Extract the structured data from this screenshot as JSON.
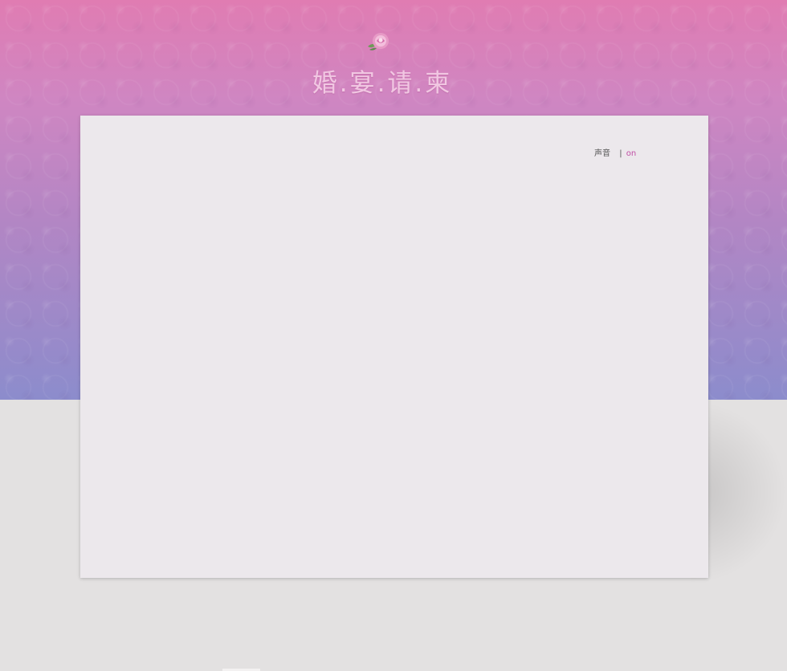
{
  "header": {
    "title": "婚.宴.请.柬",
    "logo_icon": "rose-icon"
  },
  "sound": {
    "label": "声音",
    "separator": "|",
    "state": "on"
  },
  "colors": {
    "gradient_top": "#e07cb2",
    "gradient_bottom": "#8c8ccc",
    "card_background": "#ece8ec",
    "page_background": "#e3e1e1",
    "title_color": "#f1c7e2",
    "accent": "#c04ea4"
  }
}
